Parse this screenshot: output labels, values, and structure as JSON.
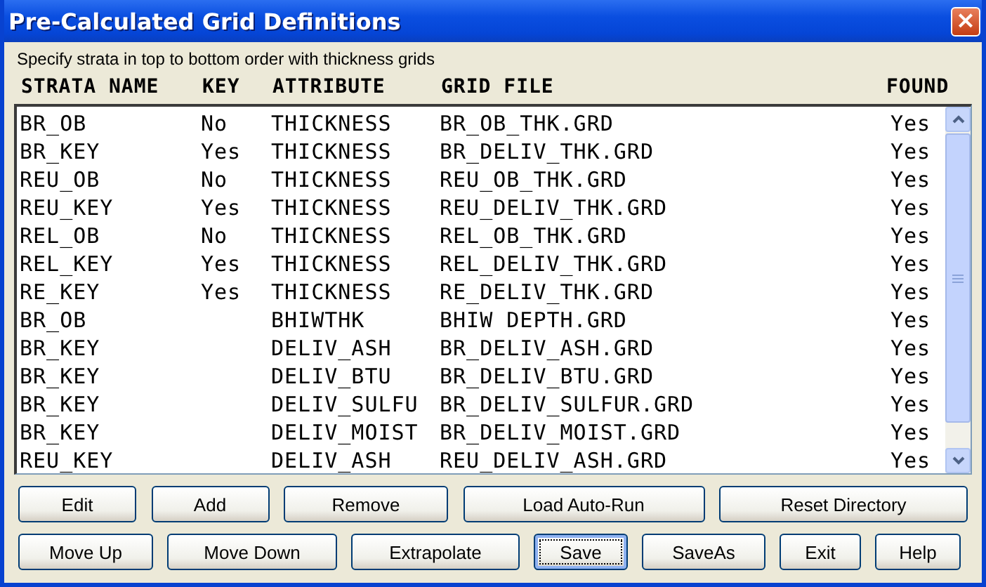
{
  "window": {
    "title": "Pre-Calculated Grid Definitions",
    "close": "×"
  },
  "instruction": "Specify strata in top to bottom order with thickness grids",
  "table": {
    "columns": [
      "STRATA NAME",
      "KEY",
      "ATTRIBUTE",
      "GRID FILE",
      "FOUND"
    ],
    "rows": [
      [
        "BR_OB",
        "No",
        "THICKNESS",
        "BR_OB_THK.GRD",
        "Yes"
      ],
      [
        "BR_KEY",
        "Yes",
        "THICKNESS",
        "BR_DELIV_THK.GRD",
        "Yes"
      ],
      [
        "REU_OB",
        "No",
        "THICKNESS",
        "REU_OB_THK.GRD",
        "Yes"
      ],
      [
        "REU_KEY",
        "Yes",
        "THICKNESS",
        "REU_DELIV_THK.GRD",
        "Yes"
      ],
      [
        "REL_OB",
        "No",
        "THICKNESS",
        "REL_OB_THK.GRD",
        "Yes"
      ],
      [
        "REL_KEY",
        "Yes",
        "THICKNESS",
        "REL_DELIV_THK.GRD",
        "Yes"
      ],
      [
        "RE_KEY",
        "Yes",
        "THICKNESS",
        "RE_DELIV_THK.GRD",
        "Yes"
      ],
      [
        "BR_OB",
        "",
        "BHIWTHK",
        "BHIW DEPTH.GRD",
        "Yes"
      ],
      [
        "BR_KEY",
        "",
        "DELIV_ASH",
        "BR_DELIV_ASH.GRD",
        "Yes"
      ],
      [
        "BR_KEY",
        "",
        "DELIV_BTU",
        "BR_DELIV_BTU.GRD",
        "Yes"
      ],
      [
        "BR_KEY",
        "",
        "DELIV_SULFU",
        "BR_DELIV_SULFUR.GRD",
        "Yes"
      ],
      [
        "BR_KEY",
        "",
        "DELIV_MOIST",
        "BR_DELIV_MOIST.GRD",
        "Yes"
      ],
      [
        "REU_KEY",
        "",
        "DELIV_ASH",
        "REU_DELIV_ASH.GRD",
        "Yes"
      ]
    ]
  },
  "button_rows": [
    [
      {
        "label": "Edit",
        "focused": false
      },
      {
        "label": "Add",
        "focused": false
      },
      {
        "label": "Remove",
        "focused": false
      },
      {
        "label": "Load Auto-Run",
        "focused": false
      },
      {
        "label": "Reset Directory",
        "focused": false
      }
    ],
    [
      {
        "label": "Move Up",
        "focused": false
      },
      {
        "label": "Move Down",
        "focused": false
      },
      {
        "label": "Extrapolate",
        "focused": false
      },
      {
        "label": "Save",
        "focused": true
      },
      {
        "label": "SaveAs",
        "focused": false
      },
      {
        "label": "Exit",
        "focused": false
      },
      {
        "label": "Help",
        "focused": false
      }
    ]
  ]
}
